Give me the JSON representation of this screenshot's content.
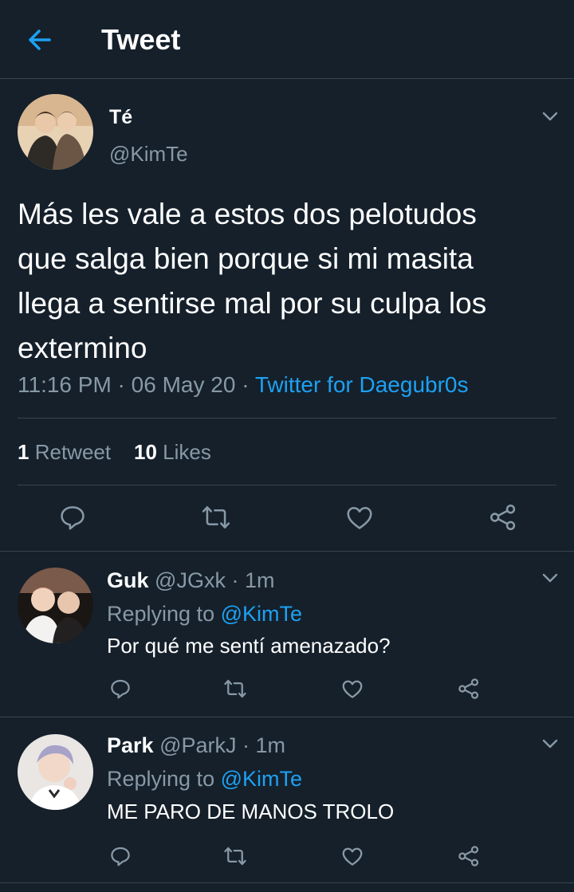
{
  "header": {
    "title": "Tweet"
  },
  "tweet": {
    "name": "Té",
    "handle": "@KimTe",
    "text": "Más les vale a estos dos pelotudos\nque salga bien porque si mi masita\nllega a sentirse mal por su culpa los\nextermino",
    "time": "11:16 PM",
    "date": "06 May 20",
    "separator": " · ",
    "source": "Twitter for Daegubr0s",
    "retweets_count": "1",
    "retweets_label": "Retweet",
    "likes_count": "10",
    "likes_label": "Likes"
  },
  "replies": [
    {
      "name": "Guk",
      "handle": "@JGxk",
      "time": "1m",
      "replying_label": "Replying to",
      "replying_to": "@KimTe",
      "text": "Por qué me sentí amenazado?"
    },
    {
      "name": "Park",
      "handle": "@ParkJ",
      "time": "1m",
      "replying_label": "Replying to",
      "replying_to": "@KimTe",
      "text": "ME PARO DE MANOS TROLO"
    }
  ],
  "colors": {
    "background": "#15202b",
    "divider": "#38444d",
    "secondary_text": "#8899a6",
    "accent": "#1da1f2"
  },
  "icons": [
    "back-arrow-icon",
    "chevron-down-icon",
    "reply-icon",
    "retweet-icon",
    "like-icon",
    "share-icon"
  ]
}
